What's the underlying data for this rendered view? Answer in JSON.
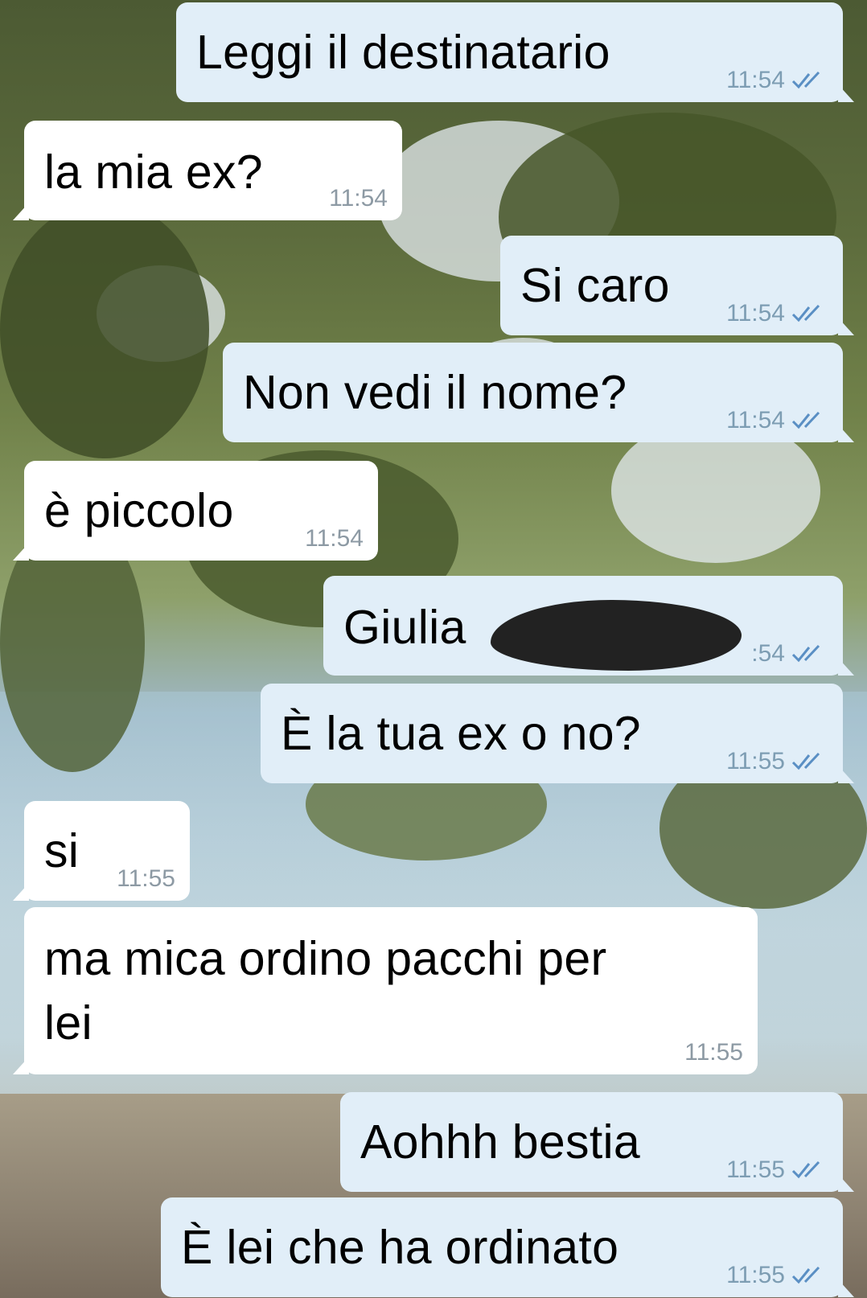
{
  "colors": {
    "outgoing_bubble": "#e1eef8",
    "incoming_bubble": "#ffffff",
    "read_ticks": "#5a8fc4",
    "timestamp": "#8d9aa4"
  },
  "messages": [
    {
      "direction": "out",
      "text": "Leggi il destinatario",
      "time": "11:54",
      "status": "read-double-check-icon"
    },
    {
      "direction": "in",
      "text": "la mia ex?",
      "time": "11:54"
    },
    {
      "direction": "out",
      "text": "Si caro",
      "time": "11:54",
      "status": "read-double-check-icon"
    },
    {
      "direction": "out",
      "text": "Non vedi il nome?",
      "time": "11:54",
      "status": "read-double-check-icon"
    },
    {
      "direction": "in",
      "text": "è piccolo",
      "time": "11:54"
    },
    {
      "direction": "out",
      "text": "Giulia",
      "time": ":54",
      "status": "read-double-check-icon",
      "redacted": true
    },
    {
      "direction": "out",
      "text": "È la tua ex o no?",
      "time": "11:55",
      "status": "read-double-check-icon"
    },
    {
      "direction": "in",
      "text": "si",
      "time": "11:55"
    },
    {
      "direction": "in",
      "text": "ma mica ordino pacchi per\nlei",
      "time": "11:55"
    },
    {
      "direction": "out",
      "text": "Aohhh bestia",
      "time": "11:55",
      "status": "read-double-check-icon"
    },
    {
      "direction": "out",
      "text": "È lei che ha ordinato",
      "time": "11:55",
      "status": "read-double-check-icon"
    }
  ]
}
